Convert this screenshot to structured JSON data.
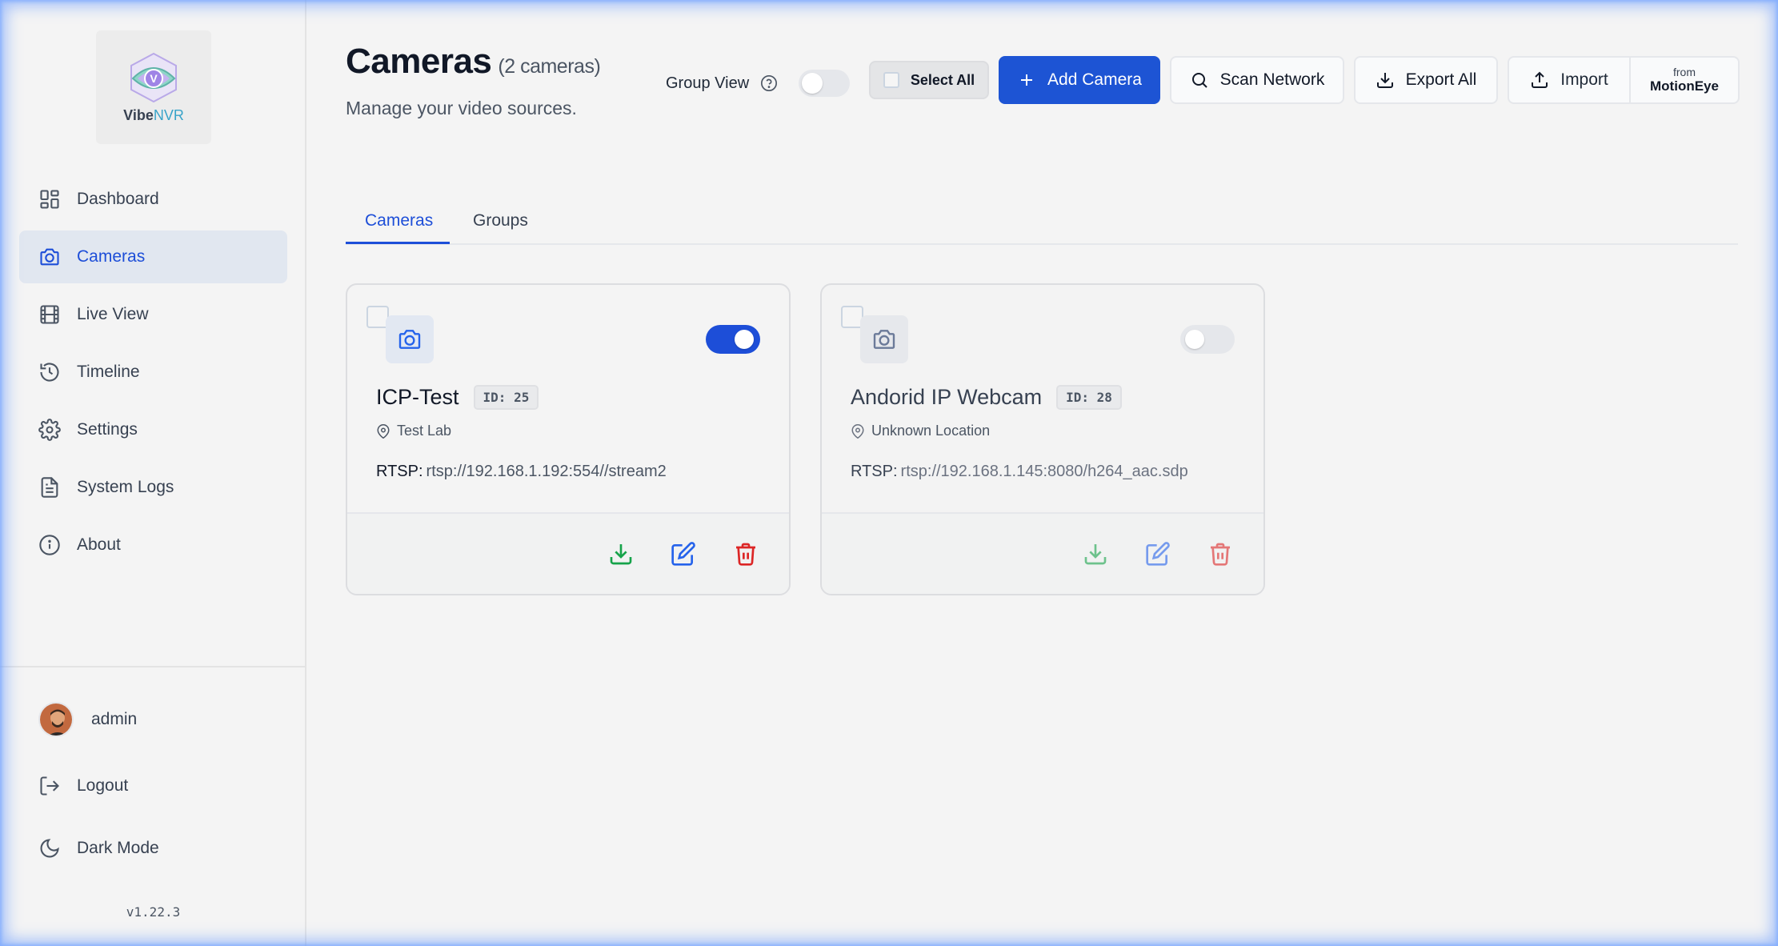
{
  "sidebar": {
    "logo": {
      "name_main": "Vibe",
      "name_accent": "NVR"
    },
    "nav": [
      {
        "label": "Dashboard",
        "icon": "dashboard-icon"
      },
      {
        "label": "Cameras",
        "icon": "camera-icon",
        "active": true
      },
      {
        "label": "Live View",
        "icon": "film-icon"
      },
      {
        "label": "Timeline",
        "icon": "history-icon"
      },
      {
        "label": "Settings",
        "icon": "gear-icon"
      },
      {
        "label": "System Logs",
        "icon": "document-icon"
      },
      {
        "label": "About",
        "icon": "info-icon"
      }
    ],
    "user": {
      "name": "admin"
    },
    "logout_label": "Logout",
    "dark_mode_label": "Dark Mode",
    "version": "v1.22.3"
  },
  "header": {
    "title": "Cameras",
    "count": "(2 cameras)",
    "subtitle": "Manage your video sources.",
    "group_view_label": "Group View",
    "group_view_on": false,
    "select_all_label": "Select All",
    "add_camera_label": "Add Camera",
    "scan_network_label": "Scan Network",
    "export_all_label": "Export All",
    "import_label": "Import",
    "import_from_label": "from",
    "import_source_label": "MotionEye"
  },
  "tabs": [
    {
      "label": "Cameras",
      "active": true
    },
    {
      "label": "Groups",
      "active": false
    }
  ],
  "cameras": [
    {
      "name": "ICP-Test",
      "id_label": "ID: 25",
      "location": "Test Lab",
      "rtsp_label": "RTSP:",
      "rtsp_url": "rtsp://192.168.1.192:554//stream2",
      "enabled": true
    },
    {
      "name": "Andorid IP Webcam",
      "id_label": "ID: 28",
      "location": "Unknown Location",
      "rtsp_label": "RTSP:",
      "rtsp_url": "rtsp://192.168.1.145:8080/h264_aac.sdp",
      "enabled": false
    }
  ],
  "colors": {
    "accent": "#1d54d4",
    "download": "#16a34a",
    "edit": "#2563eb",
    "delete": "#dc2626"
  }
}
